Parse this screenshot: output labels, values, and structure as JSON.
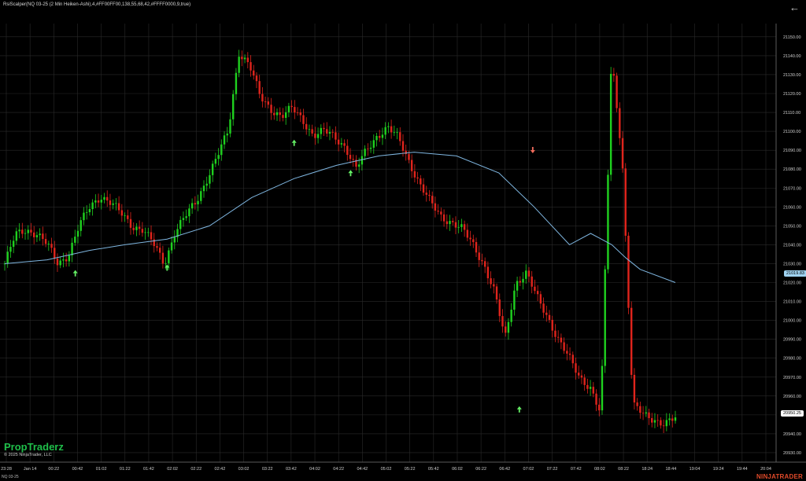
{
  "header": {
    "title": "RsiScalper(NQ 03-25 (2 Min Heiken-Ashi),4,#FF00FF00,138,55,68,42,#FFFF0000,9,true)"
  },
  "brand": "PropTraderz",
  "copyright": "© 2025 NinjaTrader, LLC",
  "instrument": "NQ 03-25",
  "logo": "NINJATRADER",
  "price_flags": {
    "ma": "21019.83",
    "last": "20950.25"
  },
  "colors": {
    "up": "#1fd11f",
    "down": "#e0241c",
    "ma": "#7fb6e0",
    "grid": "#2a2a2a",
    "arrow_up": "#66f266",
    "arrow_down": "#f26c5c"
  },
  "chart_data": {
    "type": "candlestick",
    "title": "RsiScalper(NQ 03-25 (2 Min Heiken-Ashi),4,#FF00FF00,138,55,68,42,#FFFF0000,9,true)",
    "y_axis": {
      "position": "right",
      "ylim": [
        20925,
        21157
      ],
      "tick_labels": [
        "21150.00",
        "21140.00",
        "21130.00",
        "21120.00",
        "21110.00",
        "21100.00",
        "21090.00",
        "21080.00",
        "21070.00",
        "21060.00",
        "21050.00",
        "21040.00",
        "21030.00",
        "21020.00",
        "21010.00",
        "21000.00",
        "20990.00",
        "20980.00",
        "20970.00",
        "20960.00",
        "20950.00",
        "20940.00",
        "20930.00"
      ]
    },
    "x_axis": {
      "tick_labels": [
        "23:28",
        "Jan 14",
        "00:22",
        "00:42",
        "01:02",
        "01:22",
        "01:42",
        "02:02",
        "02:22",
        "02:42",
        "03:02",
        "03:22",
        "03:42",
        "04:02",
        "04:22",
        "04:42",
        "05:02",
        "05:22",
        "05:42",
        "06:02",
        "06:22",
        "06:42",
        "07:02",
        "07:22",
        "07:42",
        "08:02",
        "08:22",
        "18:24",
        "18:44",
        "19:04",
        "19:24",
        "19:44",
        "20:04"
      ]
    },
    "grid": true,
    "series": [
      {
        "name": "Heiken-Ashi price",
        "path": [
          21030,
          21045,
          21048,
          21046,
          21040,
          21030,
          21035,
          21050,
          21060,
          21066,
          21062,
          21056,
          21050,
          21048,
          21040,
          21030,
          21047,
          21055,
          21063,
          21075,
          21087,
          21100,
          21142,
          21135,
          21118,
          21112,
          21108,
          21112,
          21106,
          21098,
          21100,
          21097,
          21092,
          21080,
          21090,
          21098,
          21102,
          21096,
          21084,
          21072,
          21062,
          21055,
          21052,
          21048,
          21040,
          21030,
          21015,
          20990,
          21020,
          21025,
          21012,
          21002,
          20990,
          20980,
          20970,
          20965,
          20950,
          21140,
          21087,
          20955,
          20950,
          20948,
          20945,
          20948
        ]
      },
      {
        "name": "Moving average",
        "x": [
          0,
          6,
          12,
          17,
          23,
          29,
          35,
          41,
          47,
          53,
          58,
          64,
          70,
          75,
          80,
          83,
          86,
          88,
          90,
          95
        ],
        "y": [
          21030,
          21032,
          21037,
          21040,
          21043,
          21050,
          21065,
          21075,
          21082,
          21087,
          21089,
          21087,
          21078,
          21060,
          21040,
          21046,
          21040,
          21033,
          21027,
          21020
        ]
      }
    ],
    "signals": [
      {
        "type": "buy",
        "x": 10,
        "price": 21027
      },
      {
        "type": "buy",
        "x": 23,
        "price": 21030
      },
      {
        "type": "buy",
        "x": 41,
        "price": 21096
      },
      {
        "type": "buy",
        "x": 49,
        "price": 21080
      },
      {
        "type": "buy",
        "x": 72.9,
        "price": 20955
      },
      {
        "type": "sell",
        "x": 74.8,
        "price": 21088
      }
    ],
    "watermark": "PropTraderz"
  }
}
